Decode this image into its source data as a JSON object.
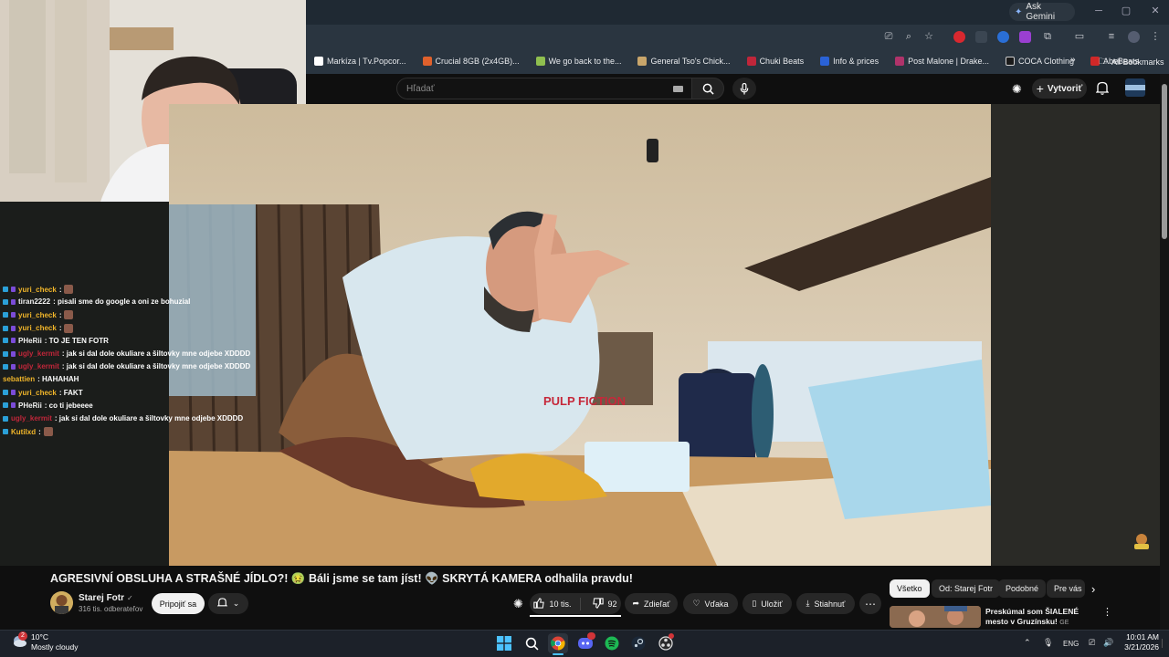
{
  "browser": {
    "ask_gemini": "Ask Gemini",
    "bookmarks": [
      {
        "label": "Markíza | Tv.Popcor...",
        "color": "#ffffff"
      },
      {
        "label": "Crucial 8GB (2x4GB)...",
        "color": "#e0612c"
      },
      {
        "label": "We go back to the...",
        "color": "#8fbf4f"
      },
      {
        "label": "General Tso's Chick...",
        "color": "#c9a66b"
      },
      {
        "label": "Chuki Beats",
        "color": "#c0263a"
      },
      {
        "label": "Info & prices",
        "color": "#2a62d6"
      },
      {
        "label": "Post Malone | Drake...",
        "color": "#b0336a"
      },
      {
        "label": "COCA Clothing",
        "color": "#1a1a1a"
      },
      {
        "label": "AbeBeats",
        "color": "#d02828"
      }
    ],
    "all_bookmarks": "All Bookmarks"
  },
  "youtube": {
    "search_placeholder": "Hľadať",
    "create_label": "Vytvoriť",
    "video_title": "AGRESIVNÍ OBSLUHA A STRAŠNÉ JÍDLO?! 🤢 Báli jsme se tam jíst! 👽 SKRYTÁ KAMERA odhalila pravdu!",
    "channel_name": "Starej Fotr",
    "subscribers": "316 tis. odberateľov",
    "subscribe_label": "Pripojiť sa",
    "likes": "10 tis.",
    "dislikes": "92",
    "share_label": "Zdieľať",
    "thanks_label": "Vďaka",
    "save_label": "Uložiť",
    "download_label": "Stiahnuť",
    "chips": [
      "Všetko",
      "Od: Starej Fotr",
      "Podobné",
      "Pre vás"
    ],
    "recommended_title": "Preskúmal som ŠIALENÉ mesto v Gruzínsku!",
    "recommended_suffix": "GE"
  },
  "chat": [
    {
      "user": "yuri_check",
      "color": "#f0b52a",
      "text": ":",
      "emote": true,
      "badges": 2
    },
    {
      "user": "tiran2222",
      "color": "#f1f1f1",
      "text": ": pisali sme do google a oni ze bohuzial",
      "emote": false,
      "badges": 2
    },
    {
      "user": "yuri_check",
      "color": "#f0b52a",
      "text": ":",
      "emote": true,
      "badges": 2
    },
    {
      "user": "yuri_check",
      "color": "#f0b52a",
      "text": ":",
      "emote": true,
      "badges": 2
    },
    {
      "user": "PHeRii",
      "color": "#f1f1f1",
      "text": ": TO JE TEN FOTR",
      "emote": false,
      "badges": 2
    },
    {
      "user": "ugly_kermit",
      "color": "#c0263a",
      "text": ": jak si dal dole okuliare a šiltovky mne odjebe XDDDD",
      "emote": false,
      "badges": 2
    },
    {
      "user": "ugly_kermit",
      "color": "#c0263a",
      "text": ": jak si dal dole okuliare a šiltovky mne odjebe XDDDD",
      "emote": false,
      "badges": 2
    },
    {
      "user": "sebattien",
      "color": "#f0b52a",
      "text": ": HAHAHAH",
      "emote": false,
      "badges": 0
    },
    {
      "user": "yuri_check",
      "color": "#f0b52a",
      "text": ": FAKT",
      "emote": false,
      "badges": 2
    },
    {
      "user": "PHeRii",
      "color": "#f1f1f1",
      "text": ": co ti jebeeee",
      "emote": false,
      "badges": 2
    },
    {
      "user": "ugly_kermit",
      "color": "#c0263a",
      "text": ": jak si dal dole okuliare a šiltovky mne odjebe XDDDD",
      "emote": false,
      "badges": 1
    },
    {
      "user": "Kutilxd",
      "color": "#f0b52a",
      "text": ":",
      "emote": true,
      "badges": 1
    }
  ],
  "taskbar": {
    "weather_temp": "10°C",
    "weather_desc": "Mostly cloudy",
    "weather_badge": "2",
    "language": "ENG",
    "time": "10:01 AM",
    "date": "3/21/2026"
  }
}
